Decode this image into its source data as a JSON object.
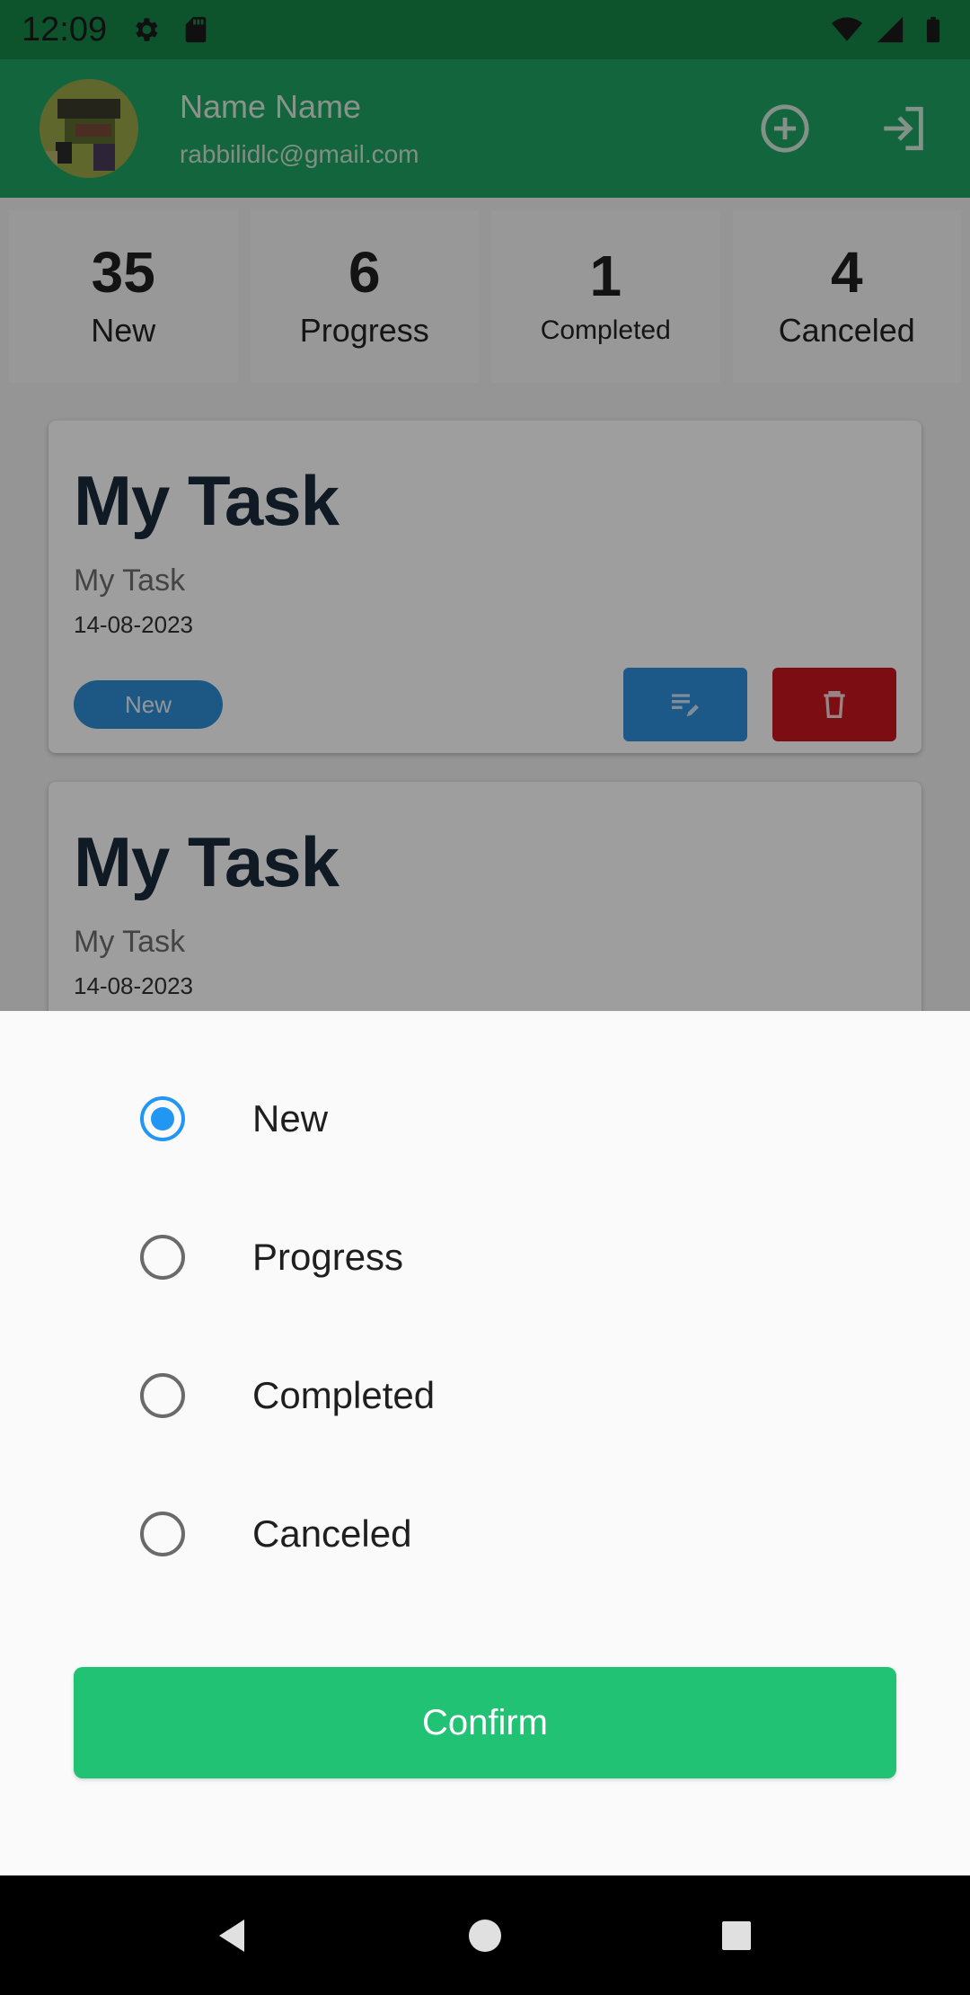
{
  "status_bar": {
    "time": "12:09"
  },
  "user": {
    "name": "Name Name",
    "email": "rabbilidlc@gmail.com"
  },
  "summary": [
    {
      "count": "35",
      "label": "New"
    },
    {
      "count": "6",
      "label": "Progress"
    },
    {
      "count": "1",
      "label": "Completed"
    },
    {
      "count": "4",
      "label": "Canceled"
    }
  ],
  "tasks": [
    {
      "title": "My Task",
      "description": "My Task",
      "date": "14-08-2023",
      "status": "New"
    },
    {
      "title": "My Task",
      "description": "My Task",
      "date": "14-08-2023"
    }
  ],
  "status_sheet": {
    "options": [
      "New",
      "Progress",
      "Completed",
      "Canceled"
    ],
    "selected": "New",
    "confirm_label": "Confirm"
  },
  "colors": {
    "app_bar": "#1fa463",
    "chip_new": "#2f8ed6",
    "edit": "#2e8fdc",
    "delete": "#c8161d",
    "confirm": "#22c274",
    "radio_selected": "#2196f3"
  }
}
